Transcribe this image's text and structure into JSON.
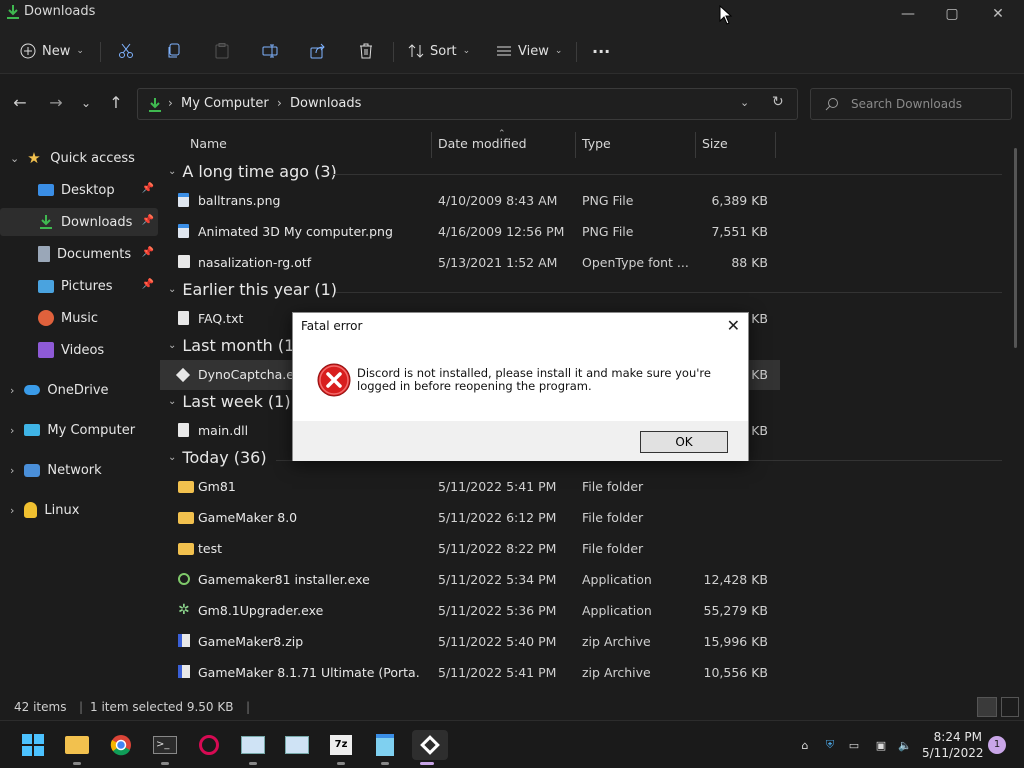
{
  "window": {
    "title": "Downloads",
    "minimize": "—",
    "maximize": "▢",
    "close": "✕"
  },
  "toolbar": {
    "new_label": "New",
    "sort_label": "Sort",
    "view_label": "View",
    "more_label": "···"
  },
  "address": {
    "segments": [
      "My Computer",
      "Downloads"
    ],
    "search_placeholder": "Search Downloads"
  },
  "sidebar": {
    "items": [
      {
        "label": "Quick access"
      },
      {
        "label": "Desktop"
      },
      {
        "label": "Downloads"
      },
      {
        "label": "Documents"
      },
      {
        "label": "Pictures"
      },
      {
        "label": "Music"
      },
      {
        "label": "Videos"
      },
      {
        "label": "OneDrive"
      },
      {
        "label": "My Computer"
      },
      {
        "label": "Network"
      },
      {
        "label": "Linux"
      }
    ]
  },
  "columns": {
    "name": "Name",
    "date": "Date modified",
    "type": "Type",
    "size": "Size"
  },
  "groups": [
    {
      "label": "A long time ago (3)"
    },
    {
      "label": "Earlier this year (1)"
    },
    {
      "label": "Last month (1)"
    },
    {
      "label": "Last week (1)"
    },
    {
      "label": "Today (36)"
    }
  ],
  "files": [
    {
      "name": "balltrans.png",
      "date": "4/10/2009 8:43 AM",
      "type": "PNG File",
      "size": "6,389 KB"
    },
    {
      "name": "Animated 3D My computer.png",
      "date": "4/16/2009 12:56 PM",
      "type": "PNG File",
      "size": "7,551 KB"
    },
    {
      "name": "nasalization-rg.otf",
      "date": "5/13/2021 1:52 AM",
      "type": "OpenType font ...",
      "size": "88 KB"
    },
    {
      "name": "FAQ.txt",
      "date": "",
      "type": "",
      "size": "KB"
    },
    {
      "name": "DynoCaptcha.e",
      "date": "",
      "type": "",
      "size": "KB"
    },
    {
      "name": "main.dll",
      "date": "",
      "type": "",
      "size": "KB"
    },
    {
      "name": "Gm81",
      "date": "5/11/2022 5:41 PM",
      "type": "File folder",
      "size": ""
    },
    {
      "name": "GameMaker 8.0",
      "date": "5/11/2022 6:12 PM",
      "type": "File folder",
      "size": ""
    },
    {
      "name": "test",
      "date": "5/11/2022 8:22 PM",
      "type": "File folder",
      "size": ""
    },
    {
      "name": "Gamemaker81 installer.exe",
      "date": "5/11/2022 5:34 PM",
      "type": "Application",
      "size": "12,428 KB"
    },
    {
      "name": "Gm8.1Upgrader.exe",
      "date": "5/11/2022 5:36 PM",
      "type": "Application",
      "size": "55,279 KB"
    },
    {
      "name": "GameMaker8.zip",
      "date": "5/11/2022 5:40 PM",
      "type": "zip Archive",
      "size": "15,996 KB"
    },
    {
      "name": "GameMaker 8.1.71 Ultimate (Porta...",
      "date": "5/11/2022 5:41 PM",
      "type": "zip Archive",
      "size": "10,556 KB"
    }
  ],
  "status": {
    "count": "42 items",
    "selected": "1 item selected  9.50 KB"
  },
  "dialog": {
    "title": "Fatal error",
    "message": "Discord is not installed, please install it and make sure you're logged in before reopening the program.",
    "ok": "OK"
  },
  "taskbar": {
    "time": "8:24 PM",
    "date": "5/11/2022",
    "notifications": "1"
  },
  "colors": {
    "accent": "#c7a5e6",
    "folder": "#f2c14e",
    "download_green": "#3fb950",
    "error_red": "#d81e1e"
  }
}
